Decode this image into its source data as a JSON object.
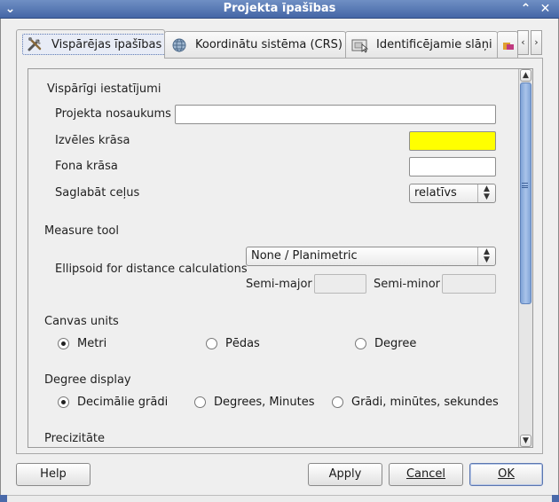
{
  "window": {
    "title": "Projekta īpašības"
  },
  "tabs": [
    {
      "label": "Vispārējas īpašības"
    },
    {
      "label": "Koordinātu sistēma (CRS)"
    },
    {
      "label": "Identificējamie slāņi"
    }
  ],
  "general": {
    "section": "Vispārīgi iestatījumi",
    "project_name_label": "Projekta nosaukums",
    "project_name_value": "",
    "selection_color_label": "Izvēles krāsa",
    "selection_color": "#ffff00",
    "background_color_label": "Fona krāsa",
    "background_color": "#ffffff",
    "save_paths_label": "Saglabāt ceļus",
    "save_paths_value": "relatīvs"
  },
  "measure": {
    "section": "Measure tool",
    "ellipsoid_label": "Ellipsoid for distance calculations",
    "ellipsoid_value": "None / Planimetric",
    "semi_major_label": "Semi-major",
    "semi_minor_label": "Semi-minor"
  },
  "canvas_units": {
    "section": "Canvas units",
    "options": [
      "Metri",
      "Pēdas",
      "Degree"
    ],
    "selected": "Metri"
  },
  "degree_display": {
    "section": "Degree display",
    "options": [
      "Decimālie grādi",
      "Degrees, Minutes",
      "Grādi, minūtes, sekundes"
    ],
    "selected": "Decimālie grādi"
  },
  "precision": {
    "section": "Precizitāte"
  },
  "buttons": {
    "help": "Help",
    "apply": "Apply",
    "cancel": "Cancel",
    "ok": "OK"
  },
  "colors": {
    "accent": "#4566a6",
    "scroll_thumb": "#7fa3d6"
  }
}
